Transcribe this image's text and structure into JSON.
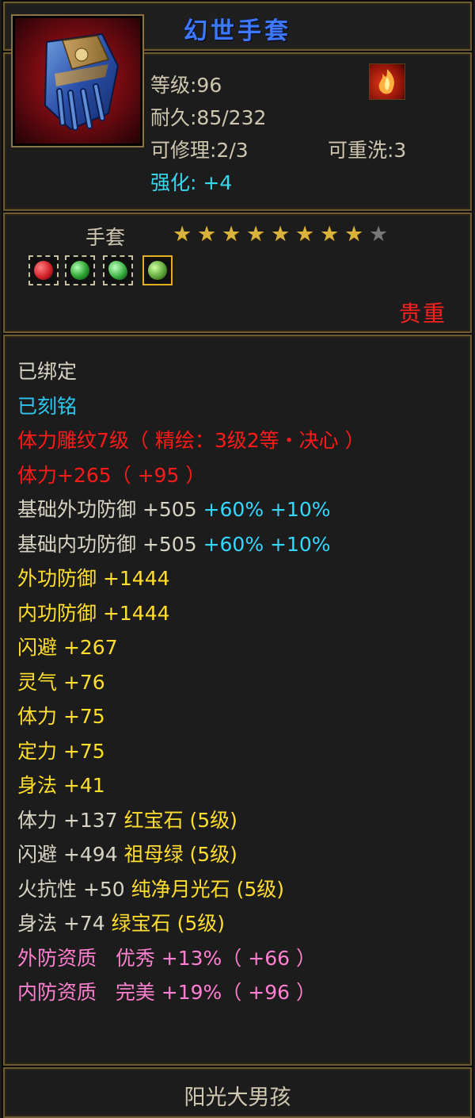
{
  "item": {
    "name": "幻世手套",
    "level": "等级:96",
    "durability": "耐久:85/232",
    "repair": "可修理:2/3",
    "rewash": "可重洗:3",
    "enhance": "强化: +4",
    "type": "手套",
    "stars_filled": 8,
    "stars_total": 9,
    "rarity": "贵重",
    "icon": "gauntlet-icon"
  },
  "gems": [
    {
      "icon": "red-gem-icon",
      "color": "#d3202a"
    },
    {
      "icon": "green-gem-icon",
      "color": "#2aa030"
    },
    {
      "icon": "green-gem-icon",
      "color": "#38b040"
    },
    {
      "icon": "green-gem-icon",
      "color": "#5ea83a"
    }
  ],
  "attributes": [
    {
      "text": "已绑定",
      "color": "white"
    },
    {
      "text": "已刻铭",
      "color": "cyan"
    },
    {
      "text": "体力雕纹7级（ 精绘：3级2等・决心 ）",
      "color": "red"
    },
    {
      "text": "体力+265（ +95 ）",
      "color": "red"
    },
    {
      "text": "基础外功防御 +505",
      "extra": "+60% +10%",
      "color": "white"
    },
    {
      "text": "基础内功防御 +505",
      "extra": "+60% +10%",
      "color": "white"
    },
    {
      "text": "外功防御 +1444",
      "color": "yellow"
    },
    {
      "text": "内功防御 +1444",
      "color": "yellow"
    },
    {
      "text": "闪避 +267",
      "color": "yellow"
    },
    {
      "text": "灵气 +76",
      "color": "yellow"
    },
    {
      "text": "体力 +75",
      "color": "yellow"
    },
    {
      "text": "定力 +75",
      "color": "yellow"
    },
    {
      "text": "身法 +41",
      "color": "yellow"
    },
    {
      "text": "体力 +137",
      "extra": "红宝石 (5级)",
      "color": "white"
    },
    {
      "text": "闪避 +494",
      "extra": "祖母绿 (5级)",
      "color": "white"
    },
    {
      "text": "火抗性 +50",
      "extra": "纯净月光石 (5级)",
      "color": "white"
    },
    {
      "text": "身法 +74",
      "extra": "绿宝石 (5级)",
      "color": "white"
    },
    {
      "text": "外防资质   优秀 +13%（ +66 ）",
      "color": "pink"
    },
    {
      "text": "内防资质   完美 +19%（ +96 ）",
      "color": "pink"
    }
  ],
  "owner": "阳光大男孩",
  "colors": {
    "title": "#3d78ff",
    "white": "#d8d4c4",
    "cyan": "#2ec6ef",
    "red": "#ff1a1a",
    "yellow": "#ffde2e",
    "pink": "#ff7fd0",
    "rarity": "#ff2020",
    "border": "#6b5a32"
  }
}
